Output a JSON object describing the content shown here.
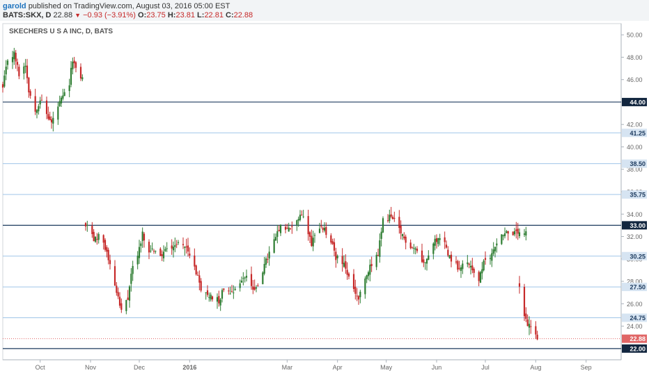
{
  "header": {
    "user": "garold",
    "published_text": "published on TradingView.com, August 03, 2016 05:00 EST",
    "symbol": "BATS:SKX, D",
    "last": "22.88",
    "change": "−0.93 (−3.91%)",
    "open_label": "O:",
    "open": "23.75",
    "high_label": "H:",
    "high": "23.81",
    "low_label": "L:",
    "low": "22.81",
    "close_label": "C:",
    "close": "22.88",
    "change_icon": "down-triangle-icon"
  },
  "colors": {
    "up": "#2e7d32",
    "down": "#c62828",
    "hline": "#9fc5e8",
    "hline_strong": "#1c3a5e",
    "label_bg": "#d6e4f2",
    "label_strong_bg": "#12263f",
    "price_label_bg": "#e06666"
  },
  "chart_data": {
    "type": "candlestick",
    "title": "SKECHERS U S A INC, D, BATS",
    "ylim": [
      21.0,
      51.0
    ],
    "y_ticks": [
      22,
      24,
      26,
      28,
      30,
      32,
      34,
      36,
      38,
      40,
      42,
      44,
      46,
      48,
      50
    ],
    "x_range": [
      "2015-09-08",
      "2016-09-14"
    ],
    "x_ticks": [
      {
        "label": "Oct",
        "date": "2015-10-01"
      },
      {
        "label": "Nov",
        "date": "2015-11-01"
      },
      {
        "label": "Dec",
        "date": "2015-12-01"
      },
      {
        "label": "2016",
        "date": "2016-01-01"
      },
      {
        "label": "Mar",
        "date": "2016-03-01"
      },
      {
        "label": "Apr",
        "date": "2016-04-01"
      },
      {
        "label": "May",
        "date": "2016-05-01"
      },
      {
        "label": "Jun",
        "date": "2016-06-01"
      },
      {
        "label": "Jul",
        "date": "2016-07-01"
      },
      {
        "label": "Aug",
        "date": "2016-08-01"
      },
      {
        "label": "Sep",
        "date": "2016-09-01"
      }
    ],
    "hlines": [
      {
        "price": 44.0,
        "label": "44.00",
        "style": "strong"
      },
      {
        "price": 41.25,
        "label": "41.25",
        "style": "light"
      },
      {
        "price": 38.5,
        "label": "38.50",
        "style": "light"
      },
      {
        "price": 35.75,
        "label": "35.75",
        "style": "light"
      },
      {
        "price": 33.0,
        "label": "33.00",
        "style": "strong"
      },
      {
        "price": 30.25,
        "label": "30.25",
        "style": "light"
      },
      {
        "price": 27.5,
        "label": "27.50",
        "style": "light"
      },
      {
        "price": 24.75,
        "label": "24.75",
        "style": "light"
      },
      {
        "price": 22.0,
        "label": "22.00",
        "style": "strong"
      }
    ],
    "last_price": {
      "price": 22.88,
      "label": "22.88"
    },
    "ohlc_series": [
      {
        "range": [
          "2015-09-08",
          "2015-10-27"
        ],
        "points": [
          [
            "2015-09-08",
            45.2
          ],
          [
            "2015-09-11",
            47.8
          ],
          [
            "2015-09-15",
            48.3
          ],
          [
            "2015-09-18",
            46.5
          ],
          [
            "2015-09-22",
            47.4
          ],
          [
            "2015-09-24",
            45.1
          ],
          [
            "2015-09-28",
            43.2
          ],
          [
            "2015-10-01",
            44.3
          ],
          [
            "2015-10-05",
            42.9
          ],
          [
            "2015-10-08",
            42.1
          ],
          [
            "2015-10-12",
            43.6
          ],
          [
            "2015-10-15",
            44.4
          ],
          [
            "2015-10-19",
            45.6
          ],
          [
            "2015-10-21",
            47.9
          ],
          [
            "2015-10-23",
            46.8
          ],
          [
            "2015-10-27",
            46.1
          ]
        ]
      },
      {
        "range": [
          "2015-10-29",
          "2016-07-26"
        ],
        "points": [
          [
            "2015-10-29",
            33.0
          ],
          [
            "2015-11-03",
            31.8
          ],
          [
            "2015-11-06",
            32.1
          ],
          [
            "2015-11-11",
            30.6
          ],
          [
            "2015-11-13",
            29.4
          ],
          [
            "2015-11-17",
            27.2
          ],
          [
            "2015-11-20",
            25.2
          ],
          [
            "2015-11-24",
            26.4
          ],
          [
            "2015-11-26",
            28.8
          ],
          [
            "2015-11-30",
            30.4
          ],
          [
            "2015-12-03",
            32.3
          ],
          [
            "2015-12-07",
            30.4
          ],
          [
            "2015-12-10",
            30.9
          ],
          [
            "2015-12-14",
            30.2
          ],
          [
            "2015-12-17",
            30.8
          ],
          [
            "2015-12-21",
            31.2
          ],
          [
            "2015-12-28",
            31.5
          ],
          [
            "2016-01-05",
            28.9
          ],
          [
            "2016-01-08",
            27.0
          ],
          [
            "2016-01-13",
            26.8
          ],
          [
            "2016-01-19",
            26.3
          ],
          [
            "2016-01-22",
            27.4
          ],
          [
            "2016-01-27",
            27.1
          ],
          [
            "2016-02-01",
            27.9
          ],
          [
            "2016-02-05",
            28.6
          ],
          [
            "2016-02-10",
            27.0
          ],
          [
            "2016-02-16",
            29.4
          ],
          [
            "2016-02-22",
            31.6
          ],
          [
            "2016-02-26",
            32.8
          ],
          [
            "2016-03-02",
            32.6
          ],
          [
            "2016-03-07",
            33.5
          ],
          [
            "2016-03-11",
            33.9
          ],
          [
            "2016-03-16",
            31.4
          ],
          [
            "2016-03-18",
            32.3
          ],
          [
            "2016-03-23",
            32.8
          ],
          [
            "2016-03-28",
            31.5
          ],
          [
            "2016-03-31",
            30.2
          ],
          [
            "2016-04-05",
            29.4
          ],
          [
            "2016-04-11",
            27.2
          ],
          [
            "2016-04-14",
            26.4
          ],
          [
            "2016-04-18",
            28.1
          ],
          [
            "2016-04-22",
            29.6
          ],
          [
            "2016-04-26",
            30.4
          ],
          [
            "2016-04-29",
            33.4
          ],
          [
            "2016-05-03",
            33.8
          ],
          [
            "2016-05-06",
            33.3
          ],
          [
            "2016-05-11",
            32.0
          ],
          [
            "2016-05-16",
            31.2
          ],
          [
            "2016-05-19",
            30.9
          ],
          [
            "2016-05-24",
            29.6
          ],
          [
            "2016-05-27",
            30.6
          ],
          [
            "2016-06-01",
            31.8
          ],
          [
            "2016-06-06",
            31.4
          ],
          [
            "2016-06-09",
            30.2
          ],
          [
            "2016-06-14",
            29.3
          ],
          [
            "2016-06-17",
            29.6
          ],
          [
            "2016-06-22",
            29.4
          ],
          [
            "2016-06-27",
            28.1
          ],
          [
            "2016-06-30",
            29.6
          ],
          [
            "2016-07-05",
            30.4
          ],
          [
            "2016-07-08",
            31.6
          ],
          [
            "2016-07-12",
            32.3
          ],
          [
            "2016-07-15",
            32.4
          ],
          [
            "2016-07-20",
            32.2
          ],
          [
            "2016-07-26",
            32.2
          ]
        ]
      },
      {
        "range": [
          "2016-07-22",
          "2016-08-02"
        ],
        "points": [
          [
            "2016-07-22",
            27.4
          ],
          [
            "2016-07-25",
            25.0
          ],
          [
            "2016-07-27",
            24.2
          ],
          [
            "2016-07-29",
            23.9
          ],
          [
            "2016-08-01",
            23.5
          ],
          [
            "2016-08-02",
            22.9
          ]
        ]
      }
    ]
  }
}
